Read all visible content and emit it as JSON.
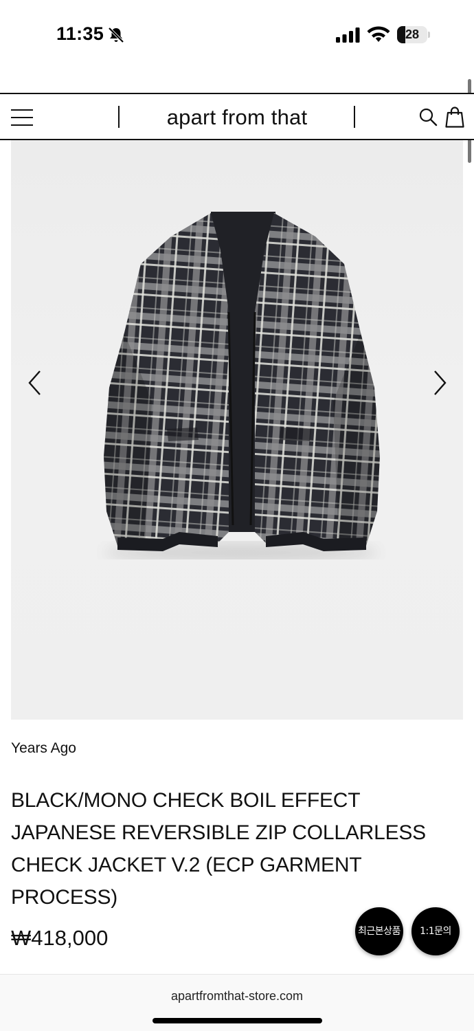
{
  "status_bar": {
    "time": "11:35",
    "battery_level": "28",
    "battery_fraction": 0.28,
    "icons": [
      "bell-slash-icon",
      "cellular-signal-icon",
      "wifi-icon",
      "battery-icon"
    ]
  },
  "header": {
    "brand": "apart from that",
    "icons": [
      "hamburger-menu-icon",
      "search-icon",
      "shopping-bag-icon"
    ]
  },
  "product": {
    "image_icons": [
      "chevron-left-icon",
      "chevron-right-icon"
    ],
    "brand_label": "Years Ago",
    "title": "BLACK/MONO CHECK BOIL EFFECT JAPANESE REVERSIBLE ZIP COLLARLESS CHECK JACKET V.2 (ECP GARMENT PROCESS)",
    "price": "₩418,000"
  },
  "floating_buttons": {
    "recent": "최근본상품",
    "inquiry": "1:1문의"
  },
  "browser": {
    "url": "apartfromthat-store.com"
  },
  "colors": {
    "text": "#111111",
    "background": "#ffffff",
    "image_background": "#eeeeee",
    "fab": "#000000"
  }
}
